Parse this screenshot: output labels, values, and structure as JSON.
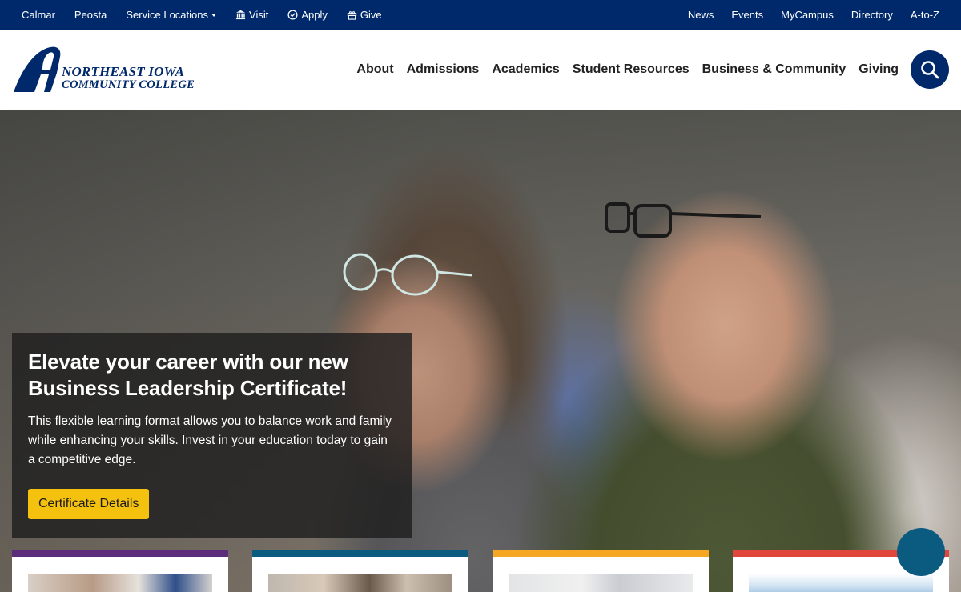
{
  "utility_left": [
    {
      "label": "Calmar"
    },
    {
      "label": "Peosta"
    },
    {
      "label": "Service Locations"
    },
    {
      "label": "Visit"
    },
    {
      "label": "Apply"
    },
    {
      "label": "Give"
    }
  ],
  "utility_right": [
    {
      "label": "News"
    },
    {
      "label": "Events"
    },
    {
      "label": "MyCampus"
    },
    {
      "label": "Directory"
    },
    {
      "label": "A-to-Z"
    }
  ],
  "logo": {
    "line1": "NORTHEAST IOWA",
    "line2": "COMMUNITY COLLEGE"
  },
  "main_nav": [
    {
      "label": "About"
    },
    {
      "label": "Admissions"
    },
    {
      "label": "Academics"
    },
    {
      "label": "Student Resources"
    },
    {
      "label": "Business & Community"
    },
    {
      "label": "Giving"
    }
  ],
  "search": {
    "icon": "search-icon"
  },
  "hero": {
    "heading": "Elevate your career with our new Business Leadership Certificate!",
    "body": "This flexible learning format allows you to balance work and family while enhancing your skills. Invest in your education today to gain a competitive edge.",
    "button": "Certificate Details"
  },
  "colors": {
    "brand_navy": "#00296b",
    "button_yellow": "#f5c10f",
    "card_purple": "#5c2d7a",
    "card_teal": "#0b5a80",
    "card_orange": "#f5a623",
    "card_red": "#e0463c",
    "chat_teal": "#0b5a80"
  }
}
